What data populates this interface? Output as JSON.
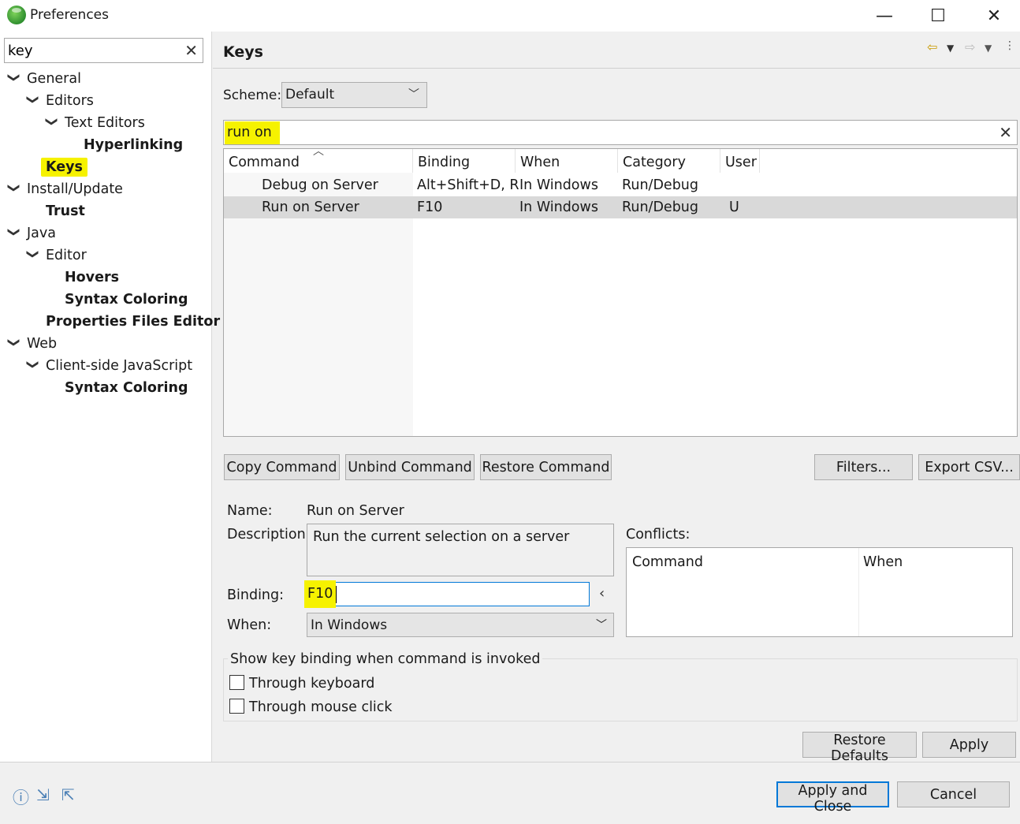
{
  "window": {
    "title": "Preferences",
    "controls": {
      "minimize": "—",
      "maximize": "☐",
      "close": "✕"
    }
  },
  "left": {
    "filter_value": "key",
    "filter_clear": "✕",
    "tree": [
      {
        "label": "General",
        "expanded": true,
        "bold": false,
        "highlight": false
      },
      {
        "label": "Editors",
        "expanded": true,
        "bold": false,
        "highlight": false
      },
      {
        "label": "Text Editors",
        "expanded": true,
        "bold": false,
        "highlight": false
      },
      {
        "label": "Hyperlinking",
        "bold": true,
        "highlight": false
      },
      {
        "label": "Keys",
        "bold": true,
        "highlight": true
      },
      {
        "label": "Install/Update",
        "expanded": true,
        "bold": false,
        "highlight": false
      },
      {
        "label": "Trust",
        "bold": true,
        "highlight": false
      },
      {
        "label": "Java",
        "expanded": true,
        "bold": false,
        "highlight": false
      },
      {
        "label": "Editor",
        "expanded": true,
        "bold": false,
        "highlight": false
      },
      {
        "label": "Hovers",
        "bold": true,
        "highlight": false
      },
      {
        "label": "Syntax Coloring",
        "bold": true,
        "highlight": false
      },
      {
        "label": "Properties Files Editor",
        "bold": true,
        "highlight": false
      },
      {
        "label": "Web",
        "expanded": true,
        "bold": false,
        "highlight": false
      },
      {
        "label": "Client-side JavaScript",
        "expanded": true,
        "bold": false,
        "highlight": false
      },
      {
        "label": "Syntax Coloring",
        "bold": true,
        "highlight": false
      }
    ]
  },
  "page": {
    "title": "Keys",
    "scheme_label": "Scheme:",
    "scheme_value": "Default",
    "filter_value": "run on",
    "filter_clear": "✕",
    "columns": [
      "Command",
      "Binding",
      "When",
      "Category",
      "User"
    ],
    "rows": [
      {
        "command": "Debug on Server",
        "binding": "Alt+Shift+D, R",
        "when": "In Windows",
        "category": "Run/Debug",
        "user": "",
        "selected": false
      },
      {
        "command": "Run on Server",
        "binding": "F10",
        "when": "In Windows",
        "category": "Run/Debug",
        "user": "U",
        "selected": true
      }
    ],
    "buttons": {
      "copy": "Copy Command",
      "unbind": "Unbind Command",
      "restore": "Restore Command",
      "filters": "Filters...",
      "export": "Export CSV..."
    },
    "details": {
      "name_label": "Name:",
      "name_value": "Run on Server",
      "description_label": "Description:",
      "description_value": "Run the current selection on a server",
      "binding_label": "Binding:",
      "binding_value": "F10",
      "when_label": "When:",
      "when_value": "In Windows",
      "conflicts_label": "Conflicts:",
      "conflicts_columns": [
        "Command",
        "When"
      ]
    },
    "show_binding": {
      "title": "Show key binding when command is invoked",
      "through_keyboard": "Through keyboard",
      "through_mouse": "Through mouse click"
    },
    "restore_defaults": "Restore Defaults",
    "apply": "Apply"
  },
  "footer": {
    "apply_close": "Apply and Close",
    "cancel": "Cancel"
  },
  "colors": {
    "highlight": "#f6f200",
    "accent": "#0078d7"
  }
}
